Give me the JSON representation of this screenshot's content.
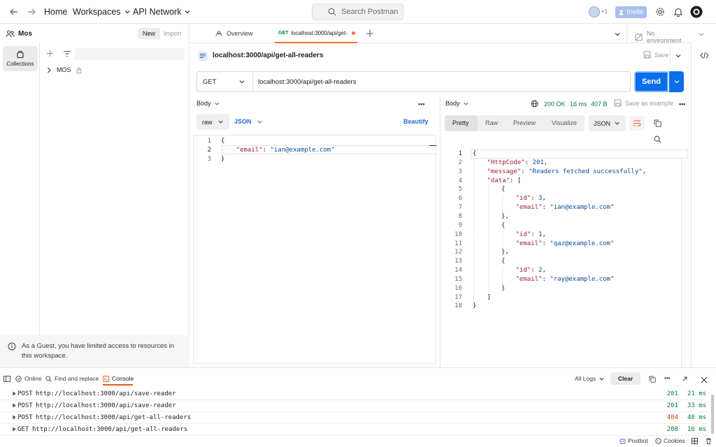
{
  "topbar": {
    "home": "Home",
    "workspaces": "Workspaces",
    "api_network": "API Network",
    "search_placeholder": "Search Postman",
    "avatars_count": "+1",
    "invite": "Invite"
  },
  "sidebar": {
    "workspace_name": "Mos",
    "new_label": "New",
    "import_label": "Import",
    "collections_label": "Collections",
    "collection_item": "MOS",
    "guest_note": "As a Guest, you have limited access to resources in this workspace."
  },
  "tabs": {
    "overview": "Overview",
    "active_method": "GET",
    "active_label": "localhost:3000/api/get-",
    "environment": "No environment"
  },
  "request": {
    "title": "localhost:3000/api/get-all-readers",
    "save_label": "Save",
    "method": "GET",
    "url": "localhost:3000/api/get-all-readers",
    "send_label": "Send",
    "body_label": "Body",
    "body_mode": "raw",
    "body_format": "JSON",
    "beautify": "Beautify",
    "body_lines": [
      {
        "n": "1",
        "text": "{"
      },
      {
        "n": "2",
        "key": "\"email\"",
        "value": "\"ian@example.com\""
      },
      {
        "n": "3",
        "text": "}"
      }
    ]
  },
  "response": {
    "body_label": "Body",
    "status": "200 OK",
    "time": "16 ms",
    "size": "407 B",
    "save_example": "Save as example",
    "view_tabs": [
      "Pretty",
      "Raw",
      "Preview",
      "Visualize"
    ],
    "format": "JSON",
    "lines": [
      {
        "n": "1",
        "indent": 0,
        "text": "{"
      },
      {
        "n": "2",
        "indent": 1,
        "key": "\"HttpCode\"",
        "value": "201",
        "tail": ","
      },
      {
        "n": "3",
        "indent": 1,
        "key": "\"message\"",
        "value": "\"Readers fetched successfully\"",
        "tail": ","
      },
      {
        "n": "4",
        "indent": 1,
        "key": "\"data\"",
        "value": "[",
        "tail": ""
      },
      {
        "n": "5",
        "indent": 2,
        "text": "{"
      },
      {
        "n": "6",
        "indent": 3,
        "key": "\"id\"",
        "value": "3",
        "tail": ","
      },
      {
        "n": "7",
        "indent": 3,
        "key": "\"email\"",
        "value": "\"ian@example.com\"",
        "tail": ""
      },
      {
        "n": "8",
        "indent": 2,
        "text": "},"
      },
      {
        "n": "9",
        "indent": 2,
        "text": "{"
      },
      {
        "n": "10",
        "indent": 3,
        "key": "\"id\"",
        "value": "1",
        "tail": ","
      },
      {
        "n": "11",
        "indent": 3,
        "key": "\"email\"",
        "value": "\"qaz@example.com\"",
        "tail": ""
      },
      {
        "n": "12",
        "indent": 2,
        "text": "},"
      },
      {
        "n": "13",
        "indent": 2,
        "text": "{"
      },
      {
        "n": "14",
        "indent": 3,
        "key": "\"id\"",
        "value": "2",
        "tail": ","
      },
      {
        "n": "15",
        "indent": 3,
        "key": "\"email\"",
        "value": "\"ray@example.com\"",
        "tail": ""
      },
      {
        "n": "16",
        "indent": 2,
        "text": "}"
      },
      {
        "n": "17",
        "indent": 1,
        "text": "]"
      },
      {
        "n": "18",
        "indent": 0,
        "text": "}"
      }
    ]
  },
  "console": {
    "online": "Online",
    "find_replace": "Find and replace",
    "console_tab": "Console",
    "log_filter": "All Logs",
    "clear": "Clear",
    "logs": [
      {
        "method": "POST",
        "url": "http://localhost:3000/api/save-reader",
        "status": "201",
        "time": "21 ms"
      },
      {
        "method": "POST",
        "url": "http://localhost:3000/api/save-reader",
        "status": "201",
        "time": "33 ms"
      },
      {
        "method": "POST",
        "url": "http://localhost:3000/api/get-all-readers",
        "status": "404",
        "time": "48 ms"
      },
      {
        "method": "GET",
        "url": "http://localhost:3000/api/get-all-readers",
        "status": "200",
        "time": "16 ms"
      }
    ]
  },
  "footer": {
    "postbot": "Postbot",
    "cookies": "Cookies"
  },
  "colors": {
    "send": "#0a6ee8",
    "accent": "#ff6c37",
    "ok": "#0b7a3e",
    "warn": "#b54708"
  }
}
